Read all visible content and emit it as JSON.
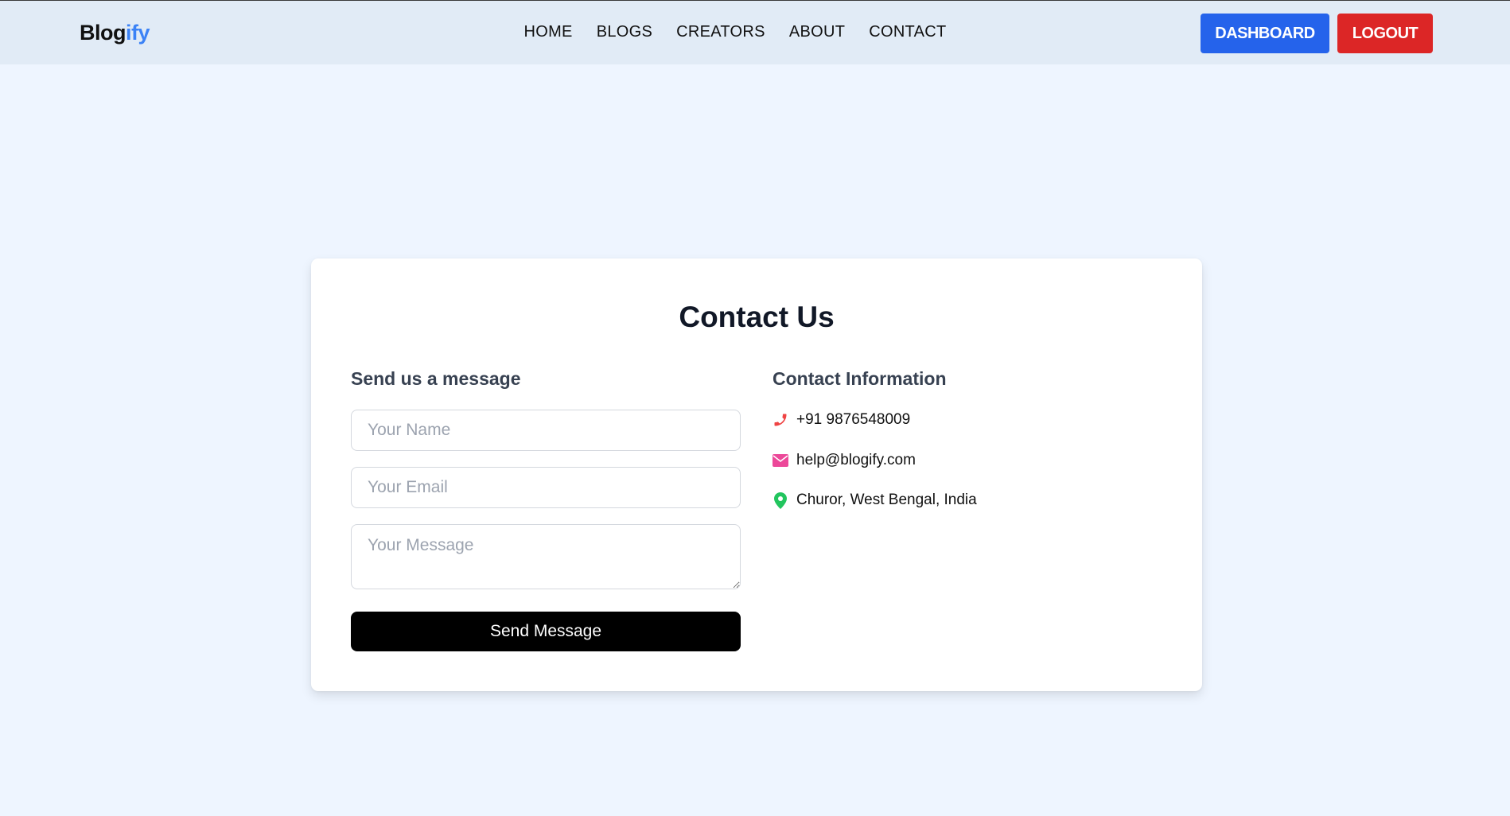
{
  "brand": {
    "logo_main": "Blog",
    "logo_accent": "ify",
    "accent_color": "#3b82f6"
  },
  "nav": {
    "links": [
      "HOME",
      "BLOGS",
      "CREATORS",
      "ABOUT",
      "CONTACT"
    ],
    "dashboard_label": "DASHBOARD",
    "logout_label": "LOGOUT"
  },
  "colors": {
    "dashboard": "#2563eb",
    "logout": "#dc2626",
    "phone_icon": "#ef4444",
    "email_icon": "#ec4899",
    "location_icon": "#22c55e"
  },
  "contact": {
    "title": "Contact Us",
    "form": {
      "heading": "Send us a message",
      "name_placeholder": "Your Name",
      "email_placeholder": "Your Email",
      "message_placeholder": "Your Message",
      "name_value": "",
      "email_value": "",
      "message_value": "",
      "submit_label": "Send Message"
    },
    "info": {
      "heading": "Contact Information",
      "phone": "+91 9876548009",
      "email": "help@blogify.com",
      "location": "Churor, West Bengal, India",
      "icons": [
        "phone-icon",
        "envelope-icon",
        "map-pin-icon"
      ]
    }
  }
}
